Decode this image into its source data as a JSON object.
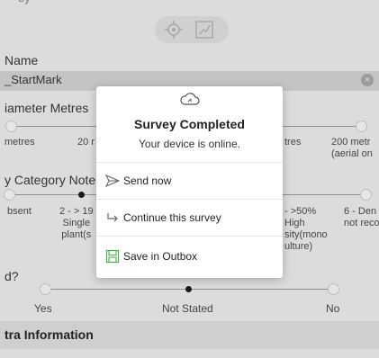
{
  "top": {
    "partial_text": "ey"
  },
  "name_field": {
    "label": "Name",
    "value": "_StartMark"
  },
  "diameter": {
    "label": "iameter Metres",
    "options": [
      "metres",
      "20 r",
      "tres",
      "200 metr\n(aerial on"
    ]
  },
  "category": {
    "label": "y Category Note *",
    "options": [
      "bsent",
      "2 - > 19\nSingle\nplant(s",
      "- >50%\nHigh\nsity(mono\nulture)",
      "6 - Den\nnot reco"
    ]
  },
  "question": {
    "label": "d?",
    "options": [
      "Yes",
      "Not Stated",
      "No"
    ],
    "selected": "Not Stated"
  },
  "section": {
    "title": "tra Information"
  },
  "modal": {
    "title": "Survey Completed",
    "subtitle": "Your device is online.",
    "actions": [
      {
        "label": "Send now",
        "icon": "send-icon"
      },
      {
        "label": "Continue this survey",
        "icon": "arrow-return-icon"
      },
      {
        "label": "Save in Outbox",
        "icon": "save-icon"
      }
    ]
  },
  "colors": {
    "accent_green": "#4caf50",
    "overlay": "#dcdcdc"
  }
}
